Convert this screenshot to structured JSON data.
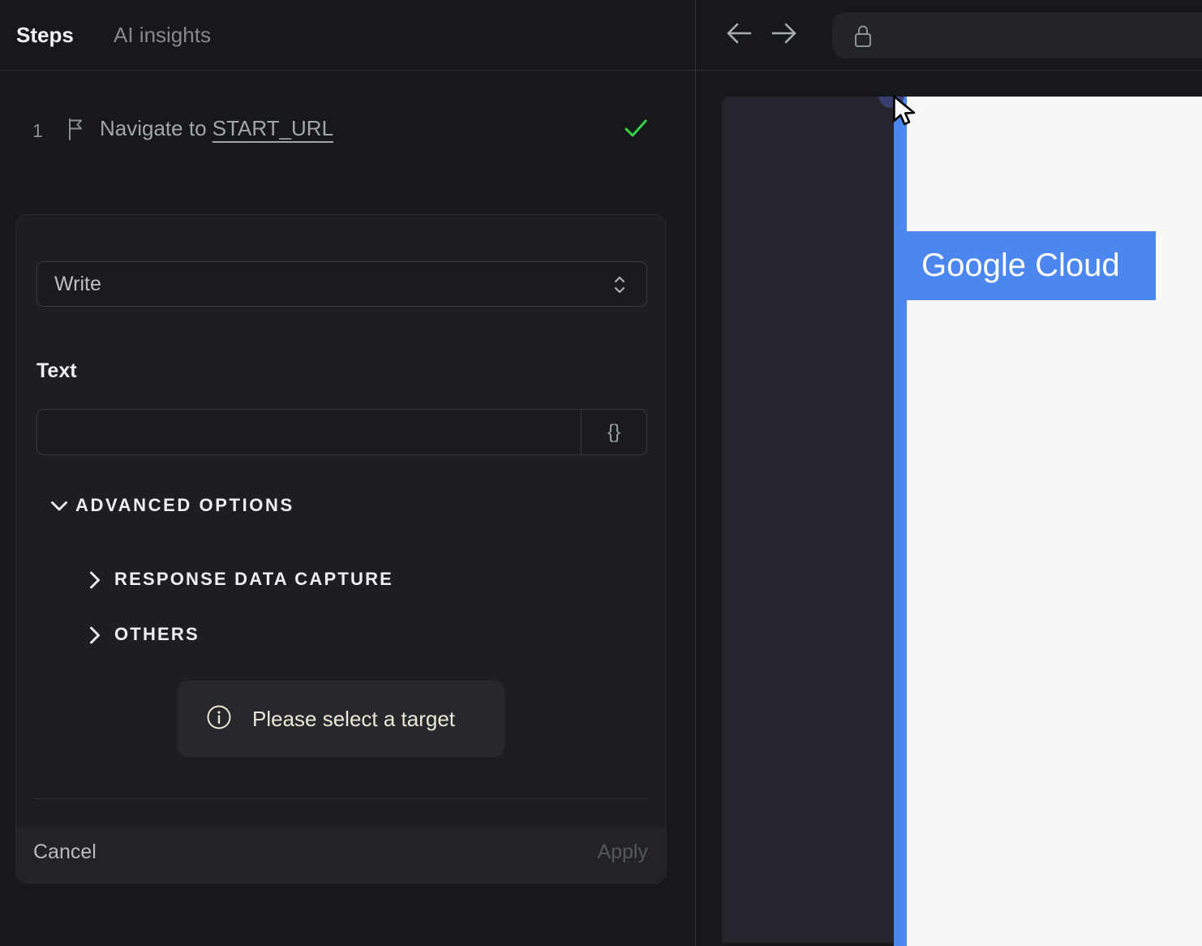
{
  "colors": {
    "accent_blue": "#4c87ef",
    "success_green": "#37d344",
    "notice_text": "#ece6d4"
  },
  "left_panel": {
    "tabs": [
      {
        "label": "Steps"
      },
      {
        "label": "AI insights"
      }
    ],
    "step": {
      "number": "1",
      "label": "Navigate to ",
      "link": "START_URL"
    },
    "editor": {
      "action_select": {
        "value": "Write"
      },
      "text_field": {
        "label": "Text",
        "value": "",
        "placeholder": "",
        "template_button": "{}"
      },
      "advanced": {
        "label": "ADVANCED OPTIONS"
      },
      "sections": [
        {
          "label": "RESPONSE DATA CAPTURE"
        },
        {
          "label": "OTHERS"
        }
      ],
      "notice": {
        "text": "Please select a target"
      },
      "footer": {
        "cancel": "Cancel",
        "apply": "Apply"
      }
    }
  },
  "right_panel": {
    "address_bar": {
      "value": ""
    },
    "page": {
      "heading": "Google Cloud"
    }
  }
}
